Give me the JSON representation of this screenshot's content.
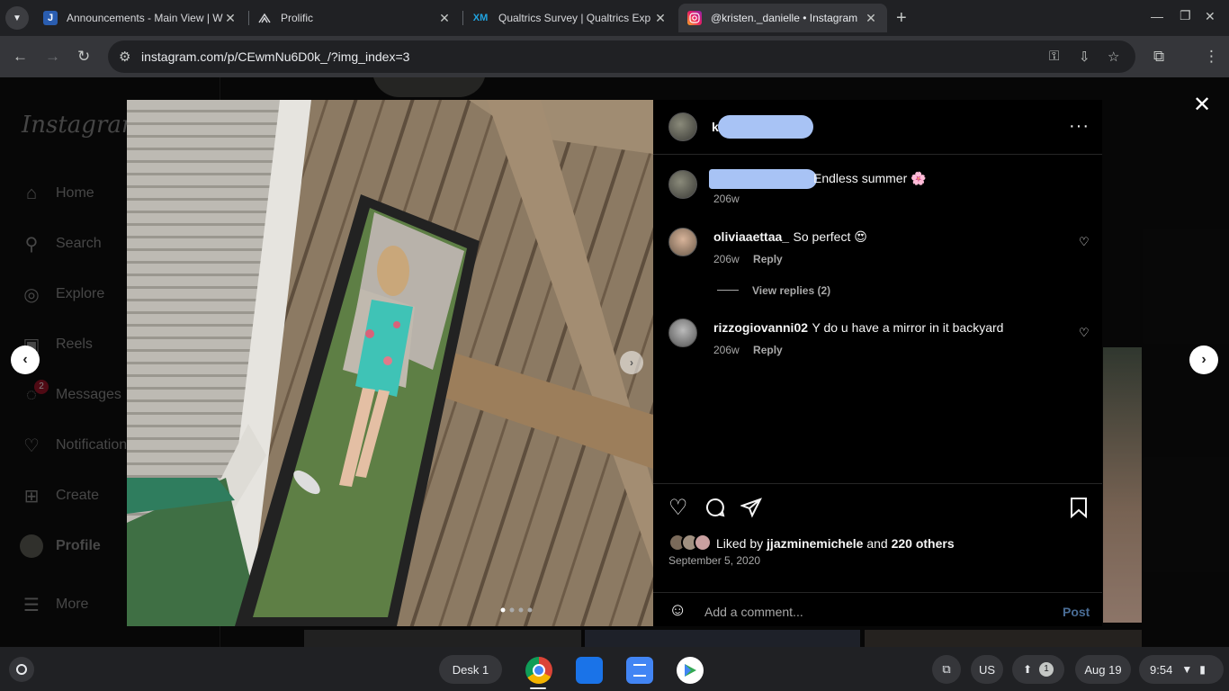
{
  "browser": {
    "tabs": [
      {
        "favicon": "J",
        "title": "Announcements - Main View | W"
      },
      {
        "favicon": "prolific-icon",
        "title": "Prolific"
      },
      {
        "favicon": "XM",
        "title": "Qualtrics Survey | Qualtrics Exp"
      },
      {
        "favicon": "instagram-icon",
        "title": "@kristen._danielle • Instagram"
      }
    ],
    "url": "instagram.com/p/CEwmNu6D0k_/?img_index=3"
  },
  "sidebar": {
    "logo": "Instagram",
    "items": [
      {
        "label": "Home",
        "icon": "home-icon"
      },
      {
        "label": "Search",
        "icon": "search-icon"
      },
      {
        "label": "Explore",
        "icon": "compass-icon"
      },
      {
        "label": "Reels",
        "icon": "reels-icon"
      },
      {
        "label": "Messages",
        "icon": "messenger-icon",
        "badge": "2"
      },
      {
        "label": "Notifications",
        "icon": "heart-icon"
      },
      {
        "label": "Create",
        "icon": "plus-square-icon"
      },
      {
        "label": "Profile",
        "icon": "avatar"
      },
      {
        "label": "More",
        "icon": "menu-icon"
      }
    ]
  },
  "post": {
    "header_initial": "k",
    "caption": "Endless summer 🌸",
    "caption_time": "206w",
    "comments": [
      {
        "user": "oliviaaettaa_",
        "text": "So perfect 😍",
        "time": "206w",
        "reply": "Reply",
        "view_replies": "View replies (2)"
      },
      {
        "user": "rizzogiovanni02",
        "text": "Y do u have a mirror in it backyard",
        "time": "206w",
        "reply": "Reply"
      }
    ],
    "liked_by_prefix": "Liked by",
    "liked_by_user": "jjazminemichele",
    "liked_by_and": "and",
    "liked_by_others": "220 others",
    "date": "September 5, 2020",
    "add_comment_placeholder": "Add a comment...",
    "post_button": "Post",
    "carousel_dots": 4,
    "carousel_active": 1
  },
  "shelf": {
    "desk": "Desk 1",
    "ime": "US",
    "notif_count": "1",
    "date": "Aug 19",
    "time": "9:54"
  }
}
